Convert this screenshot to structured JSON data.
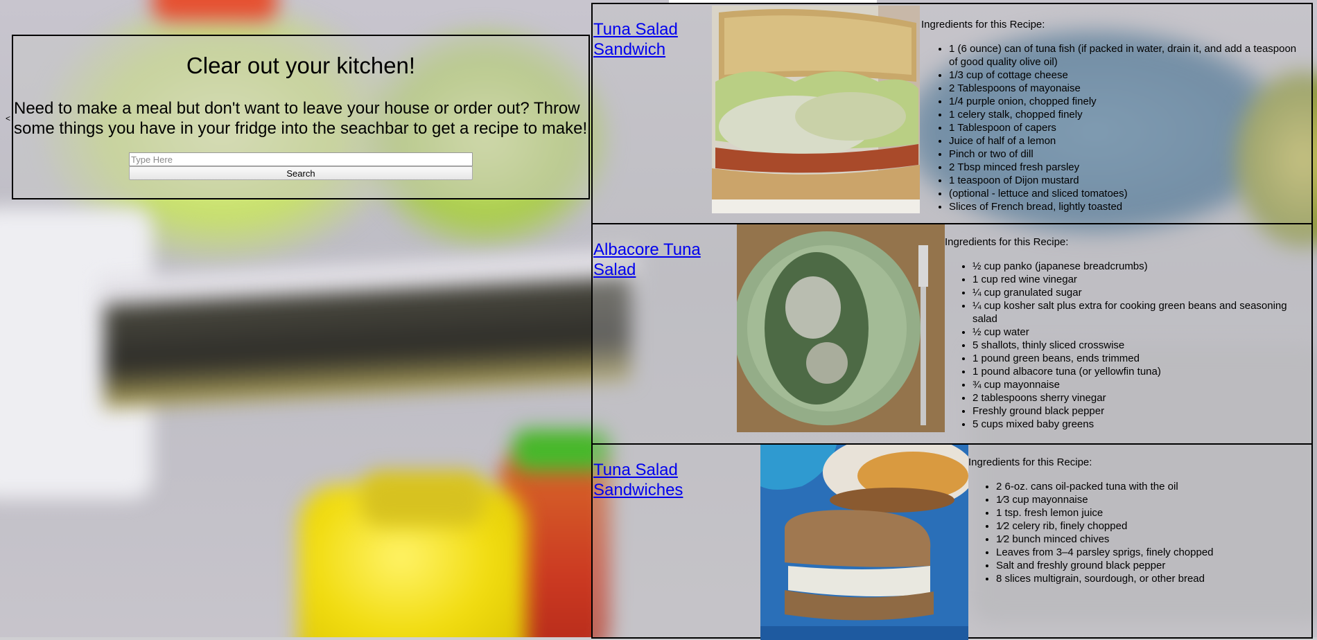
{
  "search_panel": {
    "title": "Clear out your kitchen!",
    "blurb": "Need to make a meal but don't want to leave your house or order out? Throw some things you have in your fridge into the seachbar to get a recipe to make!",
    "input_placeholder": "Type Here",
    "input_value": "",
    "search_label": "Search",
    "caret": "<"
  },
  "recipes": [
    {
      "title": "Tuna Salad Sandwich",
      "image": "tuna-salad-sandwich-photo",
      "ingredients_heading": "Ingredients for this Recipe:",
      "ingredients": [
        "1 (6 ounce) can of tuna fish (if packed in water, drain it, and add a teaspoon of good quality olive oil)",
        "1/3 cup of cottage cheese",
        "2 Tablespoons of mayonaise",
        "1/4 purple onion, chopped finely",
        "1 celery stalk, chopped finely",
        "1 Tablespoon of capers",
        "Juice of half of a lemon",
        "Pinch or two of dill",
        "2 Tbsp minced fresh parsley",
        "1 teaspoon of Dijon mustard",
        "(optional - lettuce and sliced tomatoes)",
        "Slices of French bread, lightly toasted"
      ]
    },
    {
      "title": "Albacore Tuna Salad",
      "image": "albacore-tuna-salad-photo",
      "ingredients_heading": "Ingredients for this Recipe:",
      "ingredients": [
        "½ cup panko (japanese breadcrumbs)",
        "1 cup red wine vinegar",
        "¼ cup granulated sugar",
        "¼ cup kosher salt plus extra for cooking green beans and seasoning salad",
        "½ cup water",
        "5 shallots, thinly sliced crosswise",
        "1 pound green beans, ends trimmed",
        "1 pound albacore tuna (or yellowfin tuna)",
        "¾ cup mayonnaise",
        "2 tablespoons sherry vinegar",
        "Freshly ground black pepper",
        "5 cups mixed baby greens"
      ]
    },
    {
      "title": "Tuna Salad Sandwiches",
      "image": "tuna-salad-sandwiches-photo",
      "ingredients_heading": "Ingredients for this Recipe:",
      "ingredients": [
        "2 6-oz. cans oil-packed tuna with the oil",
        "1⁄3 cup mayonnaise",
        "1 tsp. fresh lemon juice",
        "1⁄2 celery rib, finely chopped",
        "1⁄2 bunch minced chives",
        "Leaves from 3–4 parsley sprigs, finely chopped",
        "Salt and freshly ground black pepper",
        "8 slices multigrain, sourdough, or other bread"
      ]
    }
  ]
}
